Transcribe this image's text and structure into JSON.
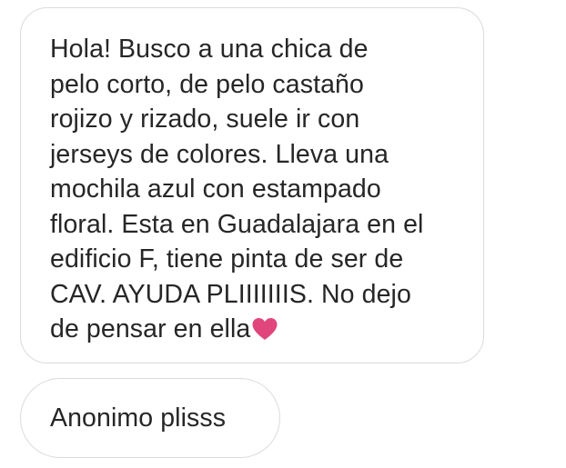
{
  "conversation": {
    "messages": [
      {
        "lines": [
          "Hola! Busco a una chica de",
          "pelo corto, de pelo castaño",
          "rojizo y rizado, suele ir con",
          "jerseys de colores. Lleva una",
          "mochila azul con estampado",
          "floral. Esta en Guadalajara en el",
          "edificio F, tiene pinta de ser de",
          "CAV. AYUDA PLIIIIIIIS. No dejo",
          "de pensar en ella"
        ],
        "trailing_icon": "heart-icon",
        "heart_color": "#e0457b"
      },
      {
        "lines": [
          "Anonimo plisss"
        ]
      }
    ],
    "colors": {
      "text": "#262626",
      "bubble_border": "#dbdbdb",
      "background": "#ffffff"
    }
  }
}
